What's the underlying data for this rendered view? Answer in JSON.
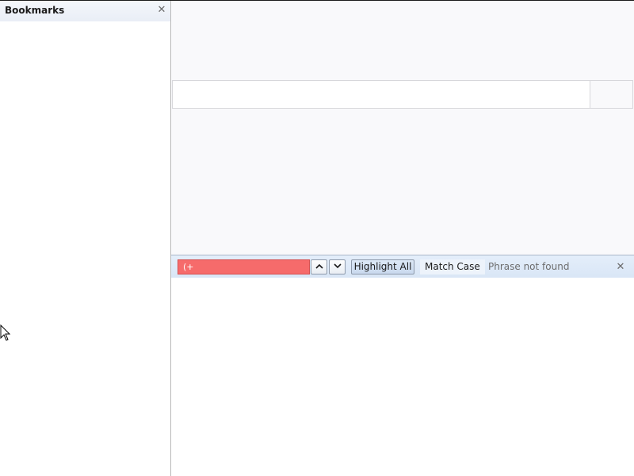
{
  "sidebar": {
    "title": "Bookmarks",
    "close_icon": "close-icon"
  },
  "findbar": {
    "search_value": "(+",
    "prev_icon": "chevron-up-icon",
    "next_icon": "chevron-down-icon",
    "highlight_all_label": "Highlight All",
    "match_case_label": "Match Case",
    "status_text": "Phrase not found",
    "close_icon": "close-icon",
    "not_found_color": "#f66b6b"
  },
  "cursor": {
    "icon": "mouse-pointer-icon"
  }
}
